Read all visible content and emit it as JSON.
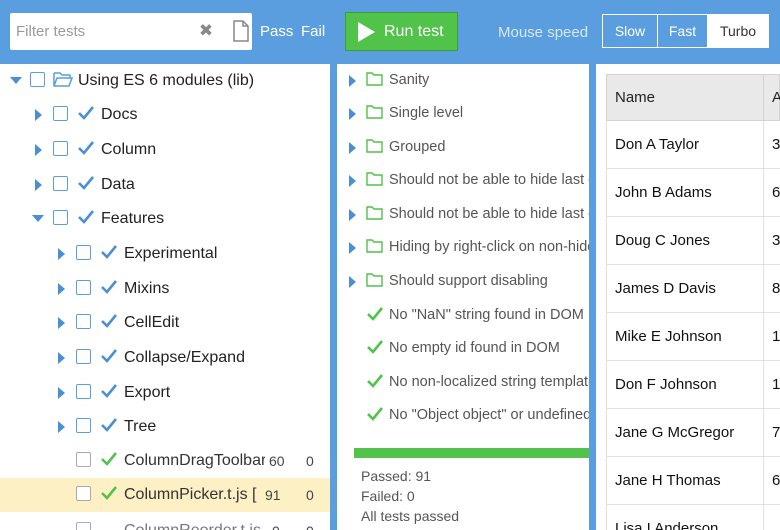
{
  "toolbar": {
    "filter_placeholder": "Filter tests",
    "clear_icon": "✖",
    "pass_label": "Pass",
    "fail_label": "Fail",
    "run_label": "Run test",
    "mouse_speed_label": "Mouse speed",
    "speed_options": [
      "Slow",
      "Fast",
      "Turbo"
    ],
    "speed_selected": "Turbo"
  },
  "tree": {
    "root_label": "Using ES 6 modules (lib)",
    "items": [
      {
        "label": "Docs",
        "state": "collapsed",
        "checked": true
      },
      {
        "label": "Column",
        "state": "collapsed",
        "checked": true
      },
      {
        "label": "Data",
        "state": "collapsed",
        "checked": true
      },
      {
        "label": "Features",
        "state": "expanded",
        "checked": true
      },
      {
        "label": "Experimental",
        "state": "collapsed",
        "checked": true
      },
      {
        "label": "Mixins",
        "state": "collapsed",
        "checked": true
      },
      {
        "label": "CellEdit",
        "state": "collapsed",
        "checked": true
      },
      {
        "label": "Collapse/Expand",
        "state": "collapsed",
        "checked": true
      },
      {
        "label": "Export",
        "state": "collapsed",
        "checked": true
      },
      {
        "label": "Tree",
        "state": "collapsed",
        "checked": true
      }
    ],
    "files": [
      {
        "label": "ColumnDragToolbar",
        "passed": "60",
        "failed": "0"
      },
      {
        "label": "ColumnPicker.t.js [ fe",
        "passed": "91",
        "failed": "0"
      },
      {
        "label": "ColumnReorder.t.js",
        "passed": "0",
        "failed": "0"
      }
    ]
  },
  "assertions": {
    "groups": [
      "Sanity",
      "Single level",
      "Grouped",
      "Should not be able to hide last co",
      "Should not be able to hide last co",
      "Hiding by right-click on non-hidea",
      "Should support disabling"
    ],
    "checks": [
      "No \"NaN\" string found in DOM",
      "No empty id found in DOM",
      "No non-localized string templates",
      "No \"Object object\" or undefined s"
    ],
    "summary": {
      "passed": "Passed: 91",
      "failed": "Failed: 0",
      "status": "All tests passed"
    }
  },
  "grid": {
    "columns": [
      "Name",
      "A"
    ],
    "rows": [
      {
        "name": "Don A Taylor",
        "age": "3"
      },
      {
        "name": "John B Adams",
        "age": "6"
      },
      {
        "name": "Doug C Jones",
        "age": "3"
      },
      {
        "name": "James D Davis",
        "age": "8"
      },
      {
        "name": "Mike E Johnson",
        "age": "1"
      },
      {
        "name": "Don F Johnson",
        "age": "1"
      },
      {
        "name": "Jane G McGregor",
        "age": "7"
      },
      {
        "name": "Jane H Thomas",
        "age": "6"
      },
      {
        "name": "Lisa I Anderson",
        "age": ""
      }
    ]
  },
  "colors": {
    "accent": "#5a9ee0",
    "success": "#51c24a",
    "selected_row": "#fdf0c4"
  }
}
